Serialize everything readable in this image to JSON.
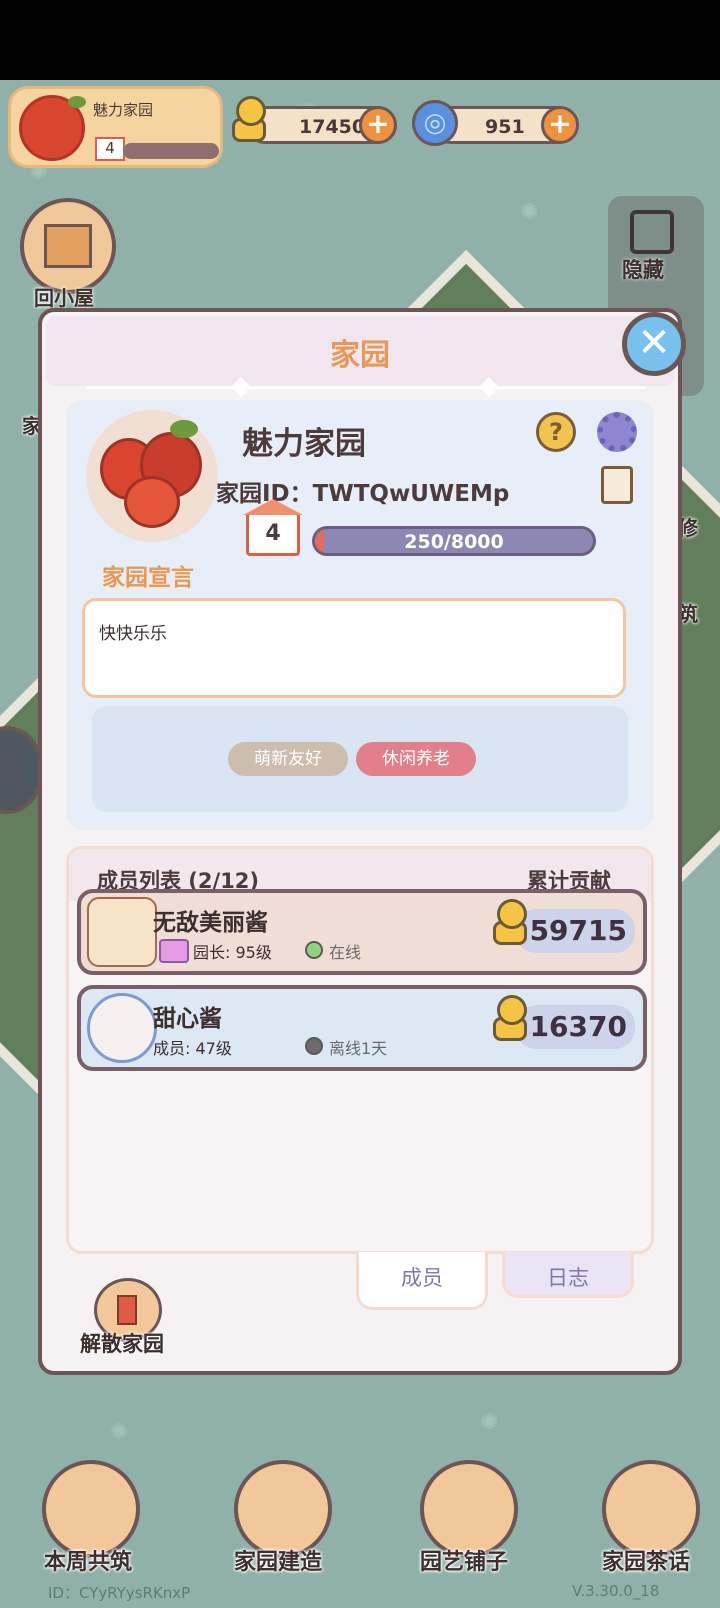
{
  "hud": {
    "garden_name": "魅力家园",
    "garden_level": "4",
    "snail_coins": "17450",
    "blue_gems": "951",
    "plus": "+"
  },
  "side": {
    "back_home": "回小屋",
    "garden_short": "家",
    "hide": "隐藏",
    "repair": "修",
    "build": "筑"
  },
  "dialog": {
    "title": "家园",
    "close": "✕",
    "garden_name": "魅力家园",
    "garden_id": "家园ID：TWTQwUWEMp",
    "level": "4",
    "exp_text": "250/8000",
    "exp_progress": 0.03125,
    "help": "?",
    "declaration_label": "家园宣言",
    "declaration_text": "快快乐乐",
    "tags": [
      "萌新友好",
      "休闲养老"
    ],
    "tag_colors": [
      "#cdbdae",
      "#e27f8a"
    ]
  },
  "members": {
    "title": "成员列表 (2/12)",
    "contribution_header": "累计贡献",
    "rows": [
      {
        "name": "无敌美丽酱",
        "role": "园长: 95级",
        "status": "在线",
        "status_color": "#8dd47c",
        "score": "59715",
        "bg": "#f0ddd6"
      },
      {
        "name": "甜心酱",
        "role": "成员: 47级",
        "status": "离线1天",
        "status_color": "#6f6a6e",
        "score": "16370",
        "bg": "#dce8f3"
      }
    ]
  },
  "tabs": {
    "members": "成员",
    "log": "日志"
  },
  "dissolve": "解散家园",
  "bottom_nav": {
    "weekly_build": "本周共筑",
    "garden_build": "家园建造",
    "garden_shop": "园艺铺子",
    "garden_chat": "家园茶话"
  },
  "footer": {
    "player_id": "ID：CYyRYysRKnxP",
    "version": "V.3.30.0_18"
  }
}
